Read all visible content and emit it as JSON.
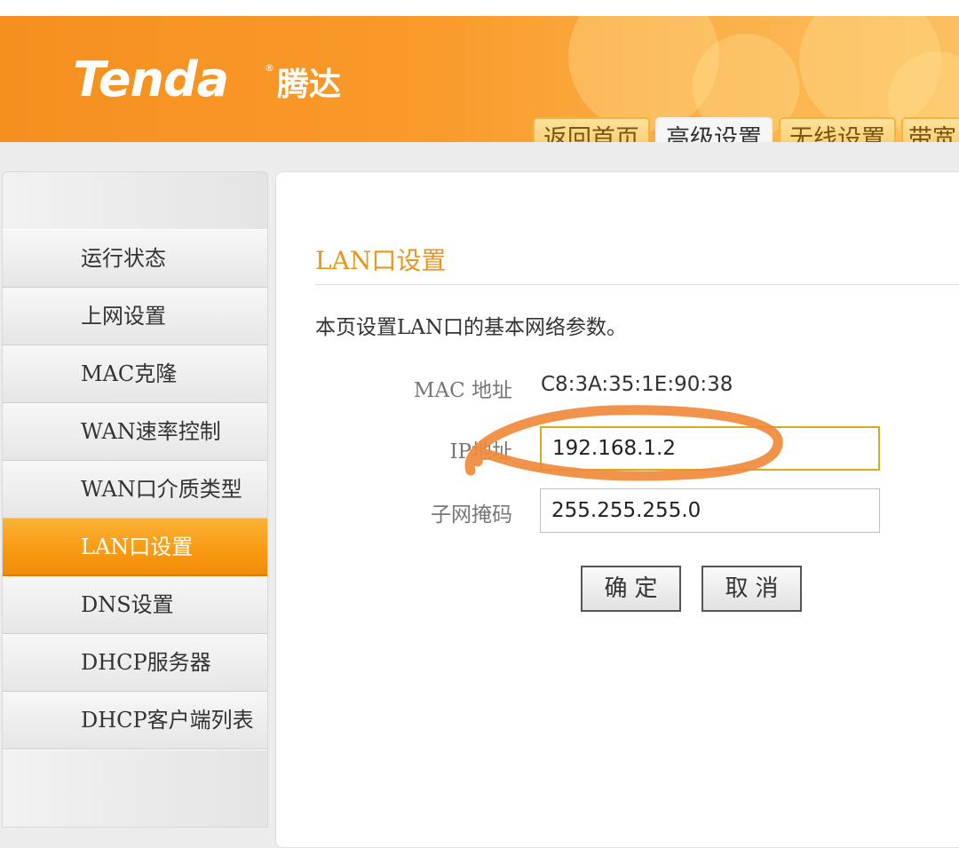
{
  "brand": {
    "logo_text": "Tenda",
    "logo_reg": "®",
    "logo_cn": "腾达"
  },
  "tabs": [
    {
      "label": "返回首页"
    },
    {
      "label": "高级设置",
      "active": true
    },
    {
      "label": "无线设置"
    },
    {
      "label": "带宽"
    }
  ],
  "sidebar": {
    "items": [
      {
        "label": "运行状态"
      },
      {
        "label": "上网设置"
      },
      {
        "label": "MAC克隆"
      },
      {
        "label": "WAN速率控制"
      },
      {
        "label": "WAN口介质类型"
      },
      {
        "label": "LAN口设置",
        "active": true
      },
      {
        "label": "DNS设置"
      },
      {
        "label": "DHCP服务器"
      },
      {
        "label": "DHCP客户端列表"
      }
    ]
  },
  "main": {
    "title": "LAN口设置",
    "description": "本页设置LAN口的基本网络参数。",
    "mac_label": "MAC 地址",
    "mac_value": "C8:3A:35:1E:90:38",
    "ip_label": "IP地址",
    "ip_value": "192.168.1.2",
    "mask_label": "子网掩码",
    "mask_value": "255.255.255.0",
    "ok_label": "确定",
    "cancel_label": "取消"
  },
  "annotation": {
    "stroke_color": "#f08a3c"
  },
  "colors": {
    "header_orange": "#f7931e",
    "title_orange": "#e8961c",
    "active_item": "#f89b14"
  }
}
